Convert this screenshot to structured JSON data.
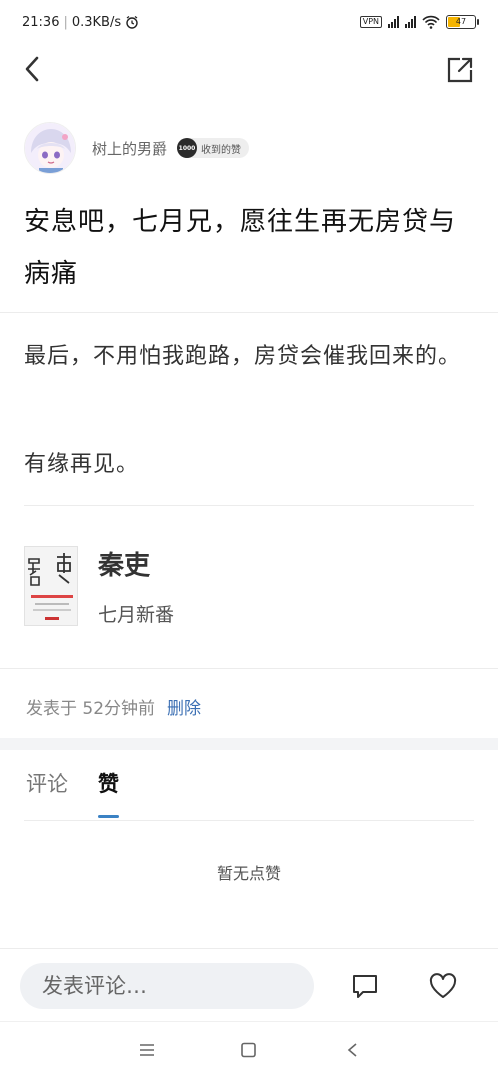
{
  "status": {
    "time": "21:36",
    "net_speed": "0.3KB/s",
    "vpn": "VPN",
    "battery": "47",
    "battery_fraction": 0.47
  },
  "author": {
    "name": "树上的男爵",
    "badge_number": "1000",
    "badge_label": "收到的赞"
  },
  "post": {
    "title": "安息吧，七月兄，愿往生再无房贷与病痛",
    "paragraphs": [
      "最后，不用怕我跑路，房贷会催我回来的。",
      "有缘再见。"
    ]
  },
  "game": {
    "name": "秦吏",
    "subtitle": "七月新番"
  },
  "meta": {
    "posted": "发表于 52分钟前",
    "delete": "删除"
  },
  "tabs": [
    {
      "label": "评论",
      "active": false
    },
    {
      "label": "赞",
      "active": true
    }
  ],
  "empty_likes": "暂无点赞",
  "comment_bar": {
    "placeholder": "发表评论…"
  },
  "icons": {
    "back": "chevron-left-icon",
    "share": "share-external-icon",
    "comment": "comment-bubble-icon",
    "like": "heart-icon",
    "alarm": "alarm-icon",
    "wifi": "wifi-icon"
  },
  "colors": {
    "accent": "#3b82c4",
    "link": "#3b6fb3",
    "battery": "#f5b400"
  }
}
